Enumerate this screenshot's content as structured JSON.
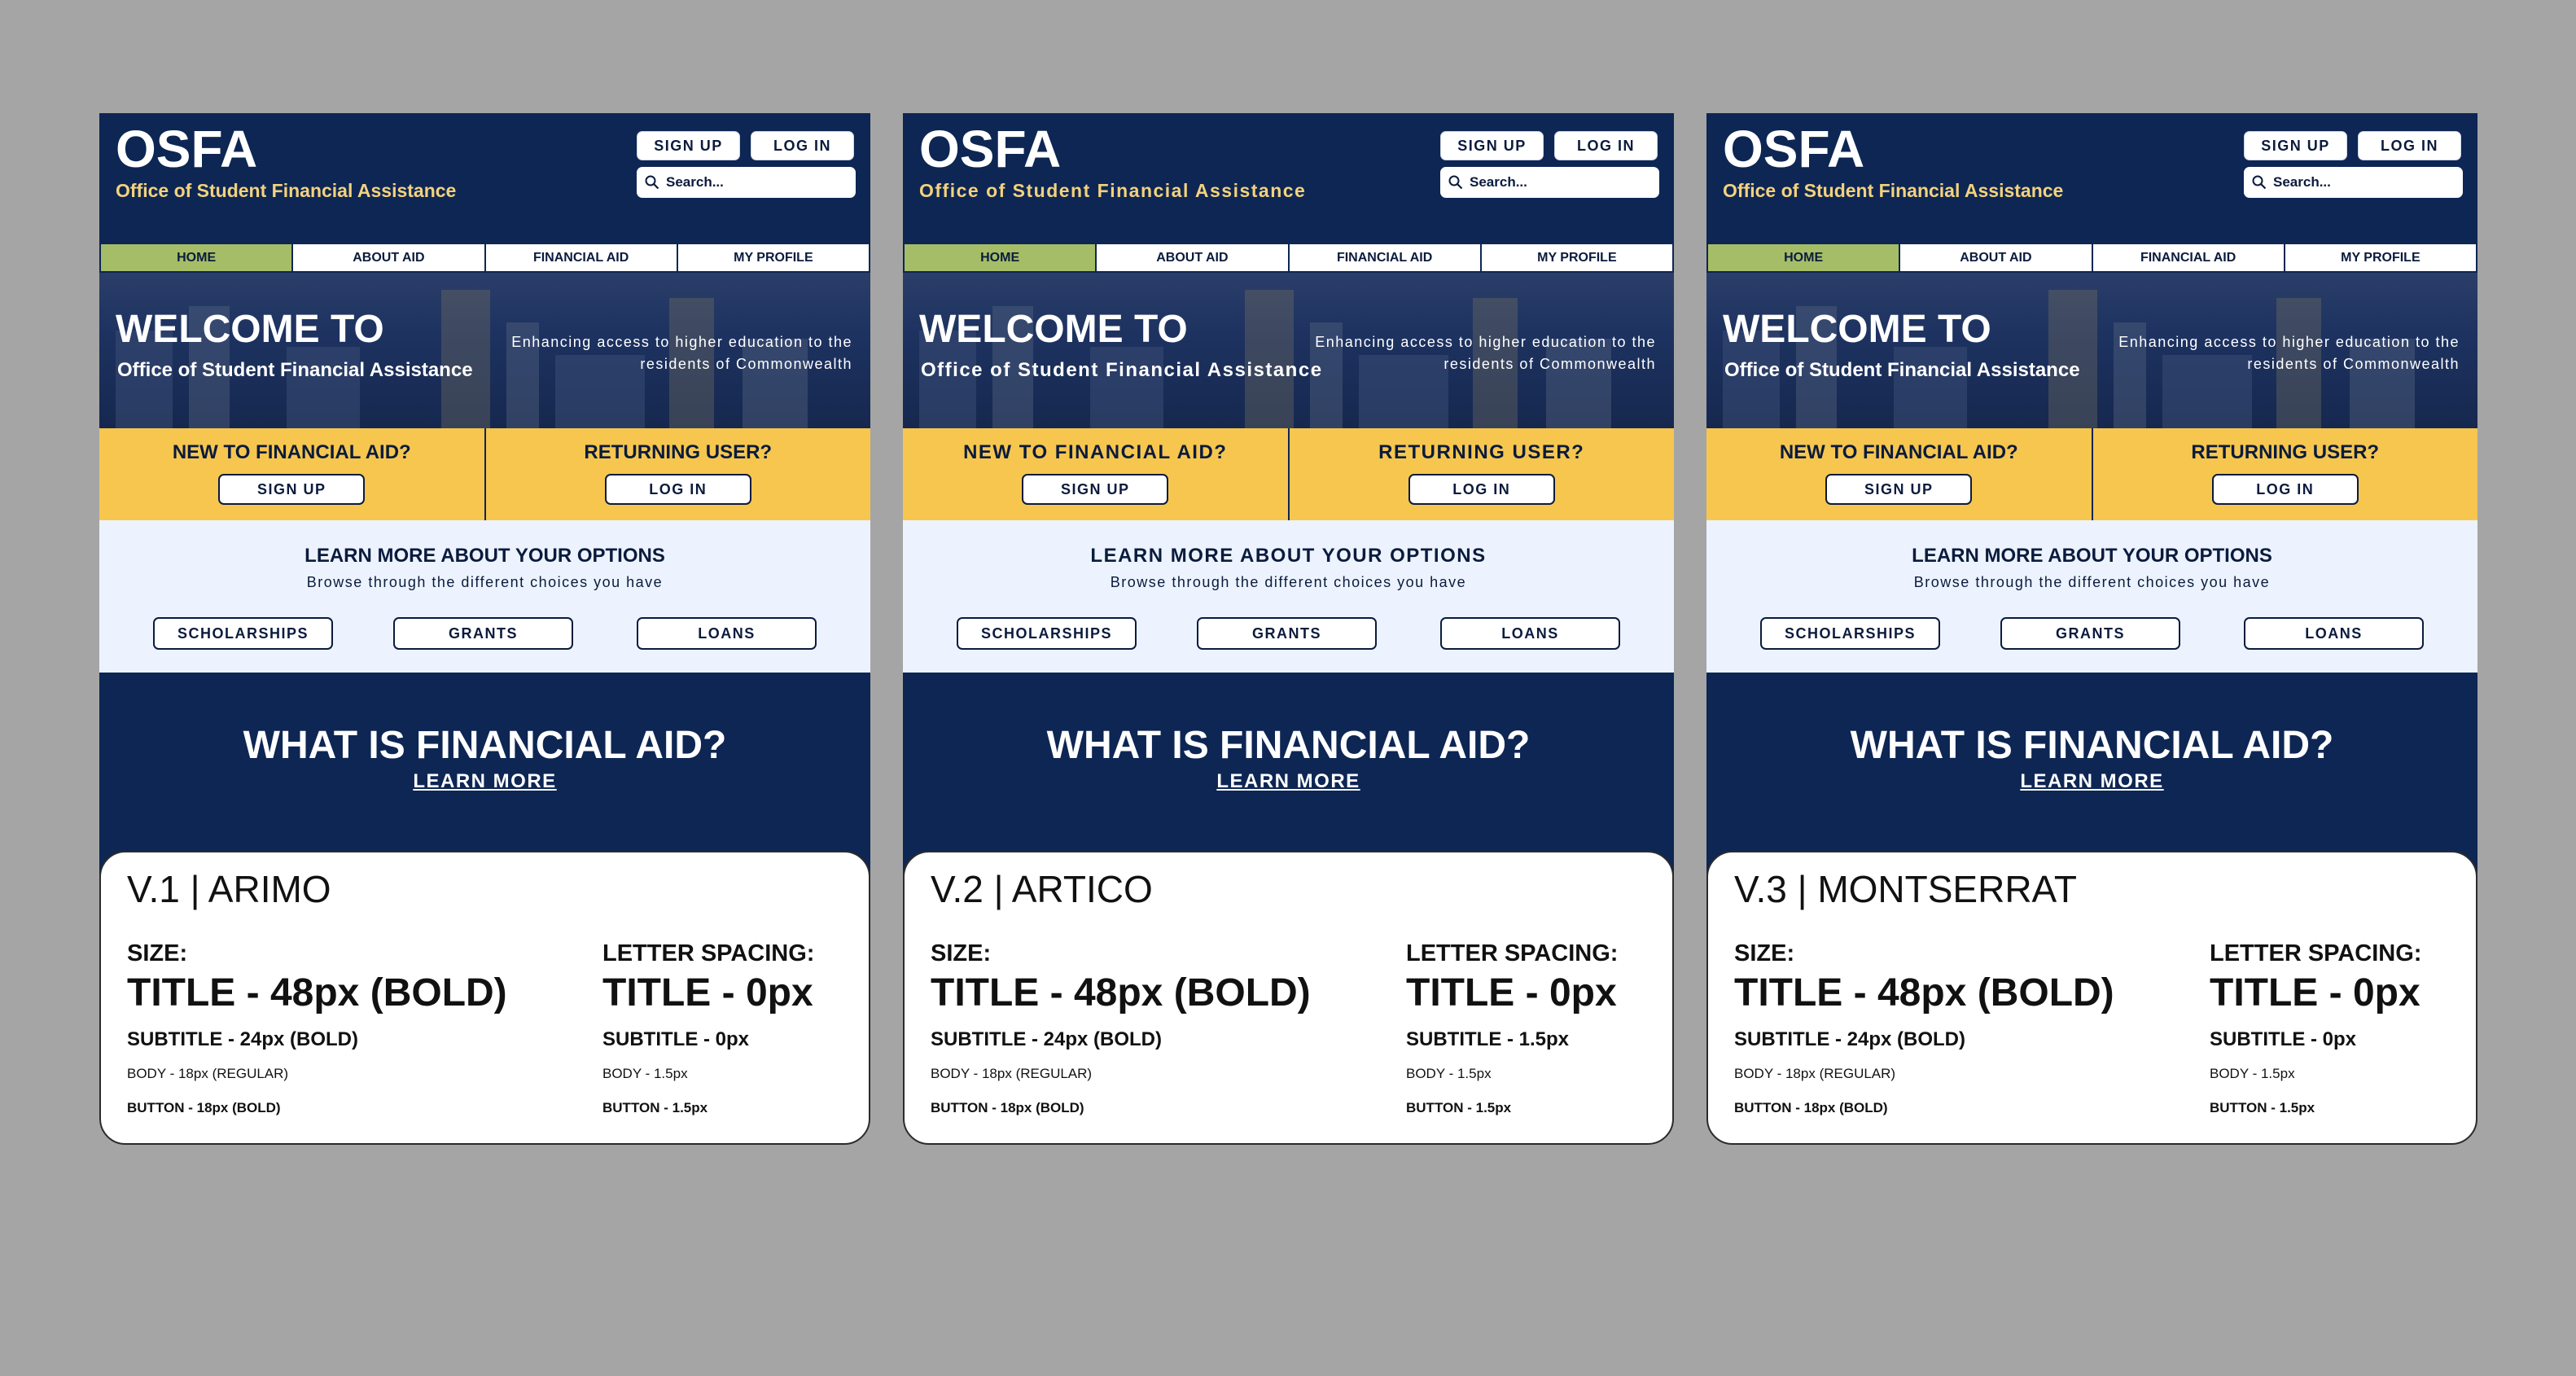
{
  "colors": {
    "navy": "#0d2654",
    "gold": "#f6c64f",
    "green": "#a5bd66",
    "light": "#ecf3fe",
    "logo_sub": "#f4d27d"
  },
  "variants": [
    {
      "mock": {
        "logo": "OSFA",
        "logo_sub": "Office of Student Financial Assistance",
        "sign_up": "SIGN UP",
        "log_in": "LOG IN",
        "search_placeholder": "Search...",
        "nav": [
          "HOME",
          "ABOUT AID",
          "FINANCIAL AID",
          "MY PROFILE"
        ],
        "hero_title": "WELCOME TO",
        "hero_sub": "Office of Student Financial Assistance",
        "hero_tag": "Enhancing access to higher education to the residents of Commonwealth",
        "new_q": "NEW TO FINANCIAL AID?",
        "ret_q": "RETURNING USER?",
        "y_signup": "SIGN UP",
        "y_login": "LOG IN",
        "opt_title": "LEARN MORE ABOUT YOUR OPTIONS",
        "opt_sub": "Browse through the different choices you have",
        "opt_buttons": [
          "SCHOLARSHIPS",
          "GRANTS",
          "LOANS"
        ],
        "faq_title": "WHAT IS FINANCIAL AID?",
        "faq_link": "LEARN MORE"
      },
      "spec": {
        "head": "V.1 | ARIMO",
        "size_label": "SIZE:",
        "spacing_label": "LETTER SPACING:",
        "title_size": "TITLE - 48px (BOLD)",
        "subtitle_size": "SUBTITLE - 24px (BOLD)",
        "body_size": "BODY - 18px (REGULAR)",
        "button_size": "BUTTON - 18px (BOLD)",
        "title_spacing": "TITLE - 0px",
        "subtitle_spacing": "SUBTITLE - 0px",
        "body_spacing": "BODY - 1.5px",
        "button_spacing": "BUTTON - 1.5px"
      }
    },
    {
      "mock": {
        "logo": "OSFA",
        "logo_sub": "Office of Student Financial Assistance",
        "sign_up": "SIGN UP",
        "log_in": "LOG IN",
        "search_placeholder": "Search...",
        "nav": [
          "HOME",
          "ABOUT AID",
          "FINANCIAL AID",
          "MY PROFILE"
        ],
        "hero_title": "WELCOME TO",
        "hero_sub": "Office of Student Financial Assistance",
        "hero_tag": "Enhancing access to higher education to the residents of Commonwealth",
        "new_q": "NEW TO FINANCIAL AID?",
        "ret_q": "RETURNING USER?",
        "y_signup": "SIGN UP",
        "y_login": "LOG IN",
        "opt_title": "LEARN MORE ABOUT YOUR OPTIONS",
        "opt_sub": "Browse through the different choices you have",
        "opt_buttons": [
          "SCHOLARSHIPS",
          "GRANTS",
          "LOANS"
        ],
        "faq_title": "WHAT IS FINANCIAL AID?",
        "faq_link": "LEARN MORE"
      },
      "spec": {
        "head": "V.2 | ARTICO",
        "size_label": "SIZE:",
        "spacing_label": "LETTER SPACING:",
        "title_size": "TITLE - 48px (BOLD)",
        "subtitle_size": "SUBTITLE - 24px (BOLD)",
        "body_size": "BODY - 18px (REGULAR)",
        "button_size": "BUTTON - 18px (BOLD)",
        "title_spacing": "TITLE - 0px",
        "subtitle_spacing": "SUBTITLE - 1.5px",
        "body_spacing": "BODY - 1.5px",
        "button_spacing": "BUTTON - 1.5px"
      }
    },
    {
      "mock": {
        "logo": "OSFA",
        "logo_sub": "Office of Student Financial Assistance",
        "sign_up": "SIGN UP",
        "log_in": "LOG IN",
        "search_placeholder": "Search...",
        "nav": [
          "HOME",
          "ABOUT AID",
          "FINANCIAL AID",
          "MY PROFILE"
        ],
        "hero_title": "WELCOME TO",
        "hero_sub": "Office of Student Financial Assistance",
        "hero_tag": "Enhancing access to higher education to the residents of Commonwealth",
        "new_q": "NEW TO FINANCIAL AID?",
        "ret_q": "RETURNING USER?",
        "y_signup": "SIGN UP",
        "y_login": "LOG IN",
        "opt_title": "LEARN MORE ABOUT YOUR OPTIONS",
        "opt_sub": "Browse through the different choices you have",
        "opt_buttons": [
          "SCHOLARSHIPS",
          "GRANTS",
          "LOANS"
        ],
        "faq_title": "WHAT IS FINANCIAL AID?",
        "faq_link": "LEARN MORE"
      },
      "spec": {
        "head": "V.3 | MONTSERRAT",
        "size_label": "SIZE:",
        "spacing_label": "LETTER SPACING:",
        "title_size": "TITLE - 48px (BOLD)",
        "subtitle_size": "SUBTITLE - 24px (BOLD)",
        "body_size": "BODY - 18px (REGULAR)",
        "button_size": "BUTTON - 18px (BOLD)",
        "title_spacing": "TITLE - 0px",
        "subtitle_spacing": "SUBTITLE - 0px",
        "body_spacing": "BODY - 1.5px",
        "button_spacing": "BUTTON - 1.5px"
      }
    }
  ]
}
